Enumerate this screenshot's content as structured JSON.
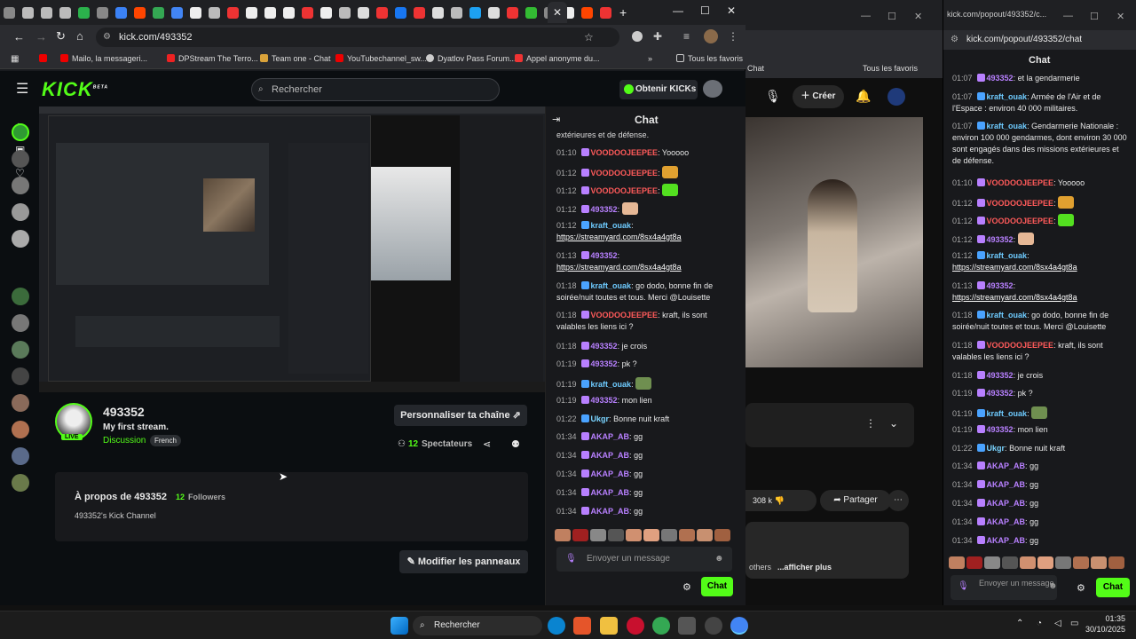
{
  "browser": {
    "url": "kick.com/493352",
    "bookmarks": [
      "Mailo, la messageri...",
      "DPStream The Terro...",
      "Team one - Chat",
      "YouTubechannel_sw...",
      "Dyatlov Pass Forum...",
      "Appel anonyme du...",
      "Tous les favoris"
    ]
  },
  "kick": {
    "logo": "KICK",
    "logo_sup": "BETA",
    "search_placeholder": "Rechercher",
    "get_kicks": "Obtenir KICKs",
    "channel": {
      "name": "493352",
      "title": "My first stream.",
      "category": "Discussion",
      "language": "French",
      "live_badge": "LIVE",
      "customize_button": "Personnaliser ta chaîne",
      "viewers_count": "12",
      "viewers_label": "Spectateurs",
      "about_prefix": "À propos de 493352",
      "followers_count": "12",
      "followers_label": "Followers",
      "about_text": "493352's Kick Channel",
      "edit_panels_button": "Modifier les panneaux"
    },
    "chat": {
      "title": "Chat",
      "truncated_line": "extérieures et de défense.",
      "messages": [
        {
          "time": "01:10",
          "user": "VOODOOJEEPEE",
          "text": "Yooooo",
          "u": "u1"
        },
        {
          "time": "01:12",
          "user": "VOODOOJEEPEE",
          "text": "",
          "u": "u1",
          "emote": "#e0a030"
        },
        {
          "time": "01:12",
          "user": "VOODOOJEEPEE",
          "text": "",
          "u": "u1",
          "emote": "#53e020"
        },
        {
          "time": "01:12",
          "user": "493352",
          "text": "",
          "u": "u3",
          "emote": "#e6b896"
        },
        {
          "time": "01:12",
          "user": "kraft_ouak",
          "text": "https://streamyard.com/8sx4a4gt8a",
          "u": "u4",
          "link": true
        },
        {
          "time": "01:13",
          "user": "493352",
          "text": "https://streamyard.com/8sx4a4gt8a",
          "u": "u3",
          "link": true
        },
        {
          "time": "01:18",
          "user": "kraft_ouak",
          "text": "go dodo, bonne fin de soirée/nuit toutes et tous. Merci @Louisette",
          "u": "u4"
        },
        {
          "time": "01:18",
          "user": "VOODOOJEEPEE",
          "text": "kraft, ils sont valables les liens ici ?",
          "u": "u1"
        },
        {
          "time": "01:18",
          "user": "493352",
          "text": "je crois",
          "u": "u3"
        },
        {
          "time": "01:19",
          "user": "493352",
          "text": "pk ?",
          "u": "u3"
        },
        {
          "time": "01:19",
          "user": "kraft_ouak",
          "text": "",
          "u": "u4",
          "emote": "#6f8f50"
        },
        {
          "time": "01:19",
          "user": "493352",
          "text": "mon lien",
          "u": "u3"
        },
        {
          "time": "01:22",
          "user": "Ukgr",
          "text": "Bonne nuit kraft",
          "u": "u5"
        },
        {
          "time": "01:34",
          "user": "AKAP_AB",
          "text": "gg",
          "u": "u3"
        },
        {
          "time": "01:34",
          "user": "AKAP_AB",
          "text": "gg",
          "u": "u3"
        },
        {
          "time": "01:34",
          "user": "AKAP_AB",
          "text": "gg",
          "u": "u3"
        },
        {
          "time": "01:34",
          "user": "AKAP_AB",
          "text": "gg",
          "u": "u3"
        },
        {
          "time": "01:34",
          "user": "AKAP_AB",
          "text": "gg",
          "u": "u3"
        }
      ],
      "input_placeholder": "Envoyer un message",
      "send_button": "Chat"
    }
  },
  "youtube": {
    "create_button": "Créer",
    "likes": "308 k",
    "share_button": "Partager",
    "comment_snippet": "others",
    "show_more": "...afficher plus",
    "favorites": "Tous les favoris",
    "chat_tab": "Chat"
  },
  "popout": {
    "url": "kick.com/popout/493352/chat",
    "title": "Chat",
    "messages": [
      {
        "time": "01:07",
        "user": "493352",
        "text": "et la gendarmerie",
        "u": "u3"
      },
      {
        "time": "01:07",
        "user": "kraft_ouak",
        "text": "Armée de l'Air et de l'Espace : environ 40 000 militaires.",
        "u": "u4"
      },
      {
        "time": "01:07",
        "user": "kraft_ouak",
        "text": "Gendarmerie Nationale : environ 100 000 gendarmes, dont environ 30 000 sont engagés dans des missions extérieures et de défense.",
        "u": "u4"
      },
      {
        "time": "01:10",
        "user": "VOODOOJEEPEE",
        "text": "Yooooo",
        "u": "u1"
      },
      {
        "time": "01:12",
        "user": "VOODOOJEEPEE",
        "text": "",
        "u": "u1",
        "emote": "#e0a030"
      },
      {
        "time": "01:12",
        "user": "VOODOOJEEPEE",
        "text": "",
        "u": "u1",
        "emote": "#53e020"
      },
      {
        "time": "01:12",
        "user": "493352",
        "text": "",
        "u": "u3",
        "emote": "#e6b896"
      },
      {
        "time": "01:12",
        "user": "kraft_ouak",
        "text": "https://streamyard.com/8sx4a4gt8a",
        "u": "u4",
        "link": true
      },
      {
        "time": "01:13",
        "user": "493352",
        "text": "https://streamyard.com/8sx4a4gt8a",
        "u": "u3",
        "link": true
      },
      {
        "time": "01:18",
        "user": "kraft_ouak",
        "text": "go dodo, bonne fin de soirée/nuit toutes et tous. Merci @Louisette",
        "u": "u4"
      },
      {
        "time": "01:18",
        "user": "VOODOOJEEPEE",
        "text": "kraft, ils sont valables les liens ici ?",
        "u": "u1"
      },
      {
        "time": "01:18",
        "user": "493352",
        "text": "je crois",
        "u": "u3"
      },
      {
        "time": "01:19",
        "user": "493352",
        "text": "pk ?",
        "u": "u3"
      },
      {
        "time": "01:19",
        "user": "kraft_ouak",
        "text": "",
        "u": "u4",
        "emote": "#6f8f50"
      },
      {
        "time": "01:19",
        "user": "493352",
        "text": "mon lien",
        "u": "u3"
      },
      {
        "time": "01:22",
        "user": "Ukgr",
        "text": "Bonne nuit kraft",
        "u": "u5"
      },
      {
        "time": "01:34",
        "user": "AKAP_AB",
        "text": "gg",
        "u": "u3"
      },
      {
        "time": "01:34",
        "user": "AKAP_AB",
        "text": "gg",
        "u": "u3"
      },
      {
        "time": "01:34",
        "user": "AKAP_AB",
        "text": "gg",
        "u": "u3"
      },
      {
        "time": "01:34",
        "user": "AKAP_AB",
        "text": "gg",
        "u": "u3"
      },
      {
        "time": "01:34",
        "user": "AKAP_AB",
        "text": "gg",
        "u": "u3"
      }
    ],
    "input_placeholder": "Envoyer un message",
    "send_button": "Chat"
  },
  "taskbar": {
    "search": "Rechercher",
    "time": "01:35",
    "date": "30/10/2025"
  }
}
